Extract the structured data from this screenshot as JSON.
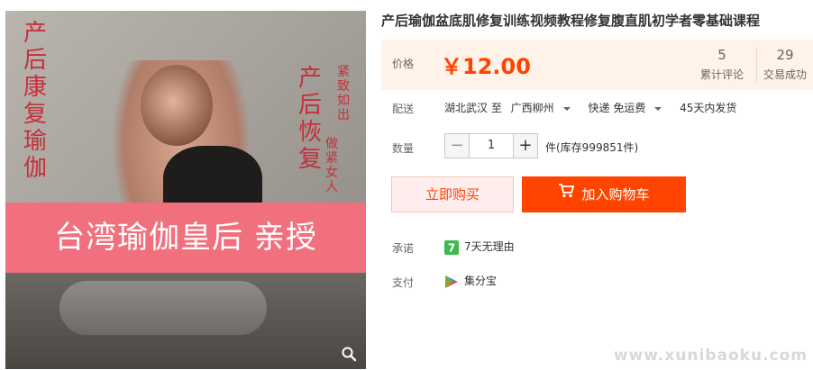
{
  "product": {
    "title": "产后瑜伽盆底肌修复训练视频教程修复腹直肌初学者零基础课程",
    "image": {
      "side_text_1": "产后",
      "side_text_2": "康复瑜伽",
      "side_text_3": "产后恢复",
      "side_text_4": "紧致如出",
      "side_text_5": "做紧女人",
      "banner_text": "台湾瑜伽皇后 亲授",
      "zoom_icon": "magnifier-icon"
    }
  },
  "price": {
    "label": "价格",
    "value": "￥12.00",
    "reviews_count": "5",
    "reviews_label": "累计评论",
    "deals_count": "29",
    "deals_label": "交易成功"
  },
  "shipping": {
    "label": "配送",
    "from": "湖北武汉 至",
    "to": "广西柳州",
    "method": "快递 免运费",
    "delivery": "45天内发货"
  },
  "quantity": {
    "label": "数量",
    "value": "1",
    "minus": "−",
    "plus": "+",
    "stock": "件(库存999851件)"
  },
  "buttons": {
    "buy_now": "立即购买",
    "add_to_cart": "加入购物车"
  },
  "promise": {
    "label": "承诺",
    "badge": "7",
    "text": "7天无理由"
  },
  "payment": {
    "label": "支付",
    "text": "集分宝"
  },
  "watermark": "www.xunibaoku.com",
  "colors": {
    "accent": "#ff4400",
    "price_bg": "#fff2e8",
    "banner": "#f0707e",
    "image_text": "#c5303c"
  }
}
